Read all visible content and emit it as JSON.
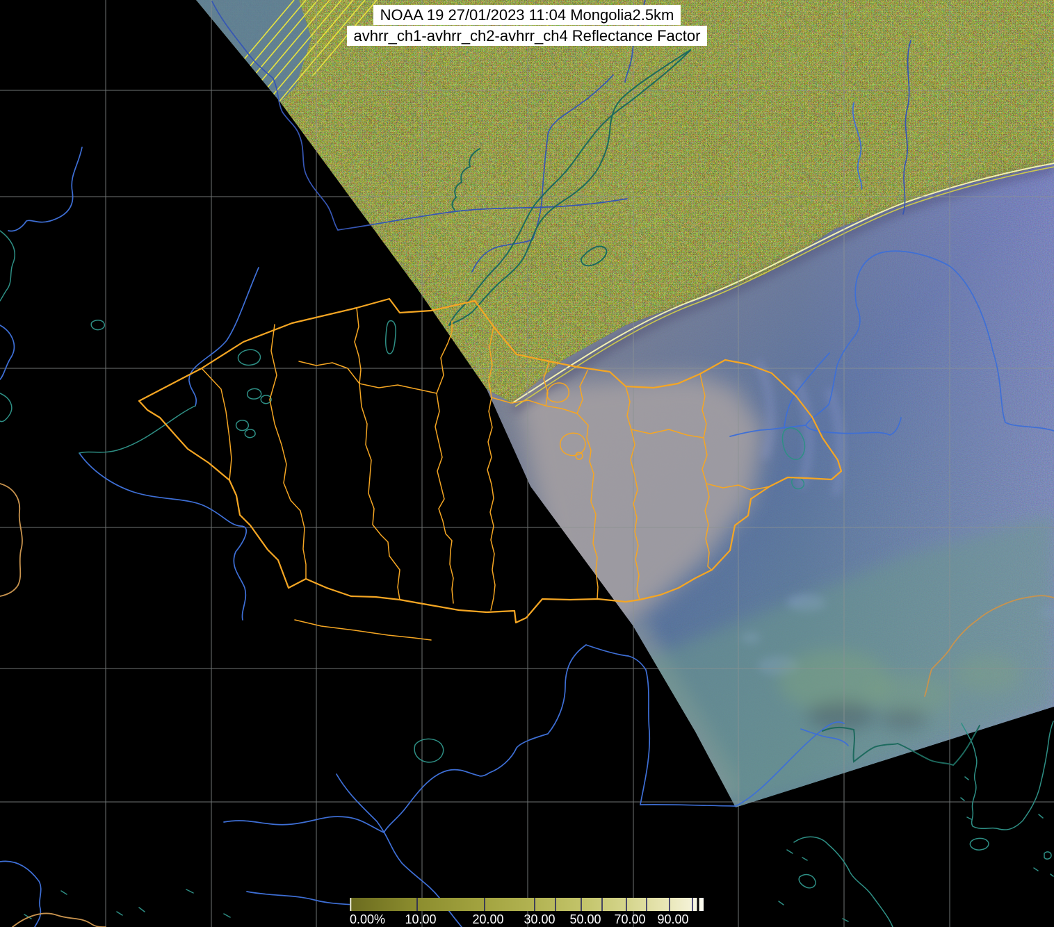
{
  "title": {
    "line1": "NOAA 19 27/01/2023 11:04 Mongolia2.5km",
    "line2": "avhrr_ch1-avhrr_ch2-avhrr_ch4 Reflectance Factor"
  },
  "scene": {
    "satellite": "NOAA 19",
    "date": "27/01/2023",
    "time": "11:04",
    "area": "Mongolia",
    "resolution": "2.5km",
    "channels": [
      "avhrr_ch1",
      "avhrr_ch2",
      "avhrr_ch4"
    ],
    "product": "Reflectance Factor"
  },
  "colorbar": {
    "labels": [
      "0.00%",
      "10.00",
      "20.00",
      "30.00",
      "50.00",
      "70.00",
      "90.00"
    ],
    "values": [
      0,
      10,
      20,
      30,
      50,
      70,
      90
    ],
    "gradient": [
      "#6b6b1f",
      "#8c8d2e",
      "#a3a440",
      "#b2b352",
      "#c3c46a",
      "#d6d68e",
      "#e6e4b0",
      "#f3f1d4",
      "#fdfcf2"
    ]
  },
  "colors": {
    "background": "#000000",
    "graticule": "#8b9292",
    "river_blue": "#3e6fd6",
    "river_dark": "#3656b4",
    "coast_teal": "#2e8f85",
    "coast_dark_teal": "#1d6a5e",
    "border_orange": "#f5a623",
    "border_tan": "#c8934e",
    "day_noise_base": "#b9bd4e",
    "terminator_line": "#e8e84a",
    "night_slate": "#5f7ba6",
    "night_teal": "#6f9b8e",
    "fog_gray": "#a7a1a3",
    "purple_noise": "#5c4a88",
    "tick_navy": "#1a1a5a",
    "label_white": "#ffffff"
  }
}
